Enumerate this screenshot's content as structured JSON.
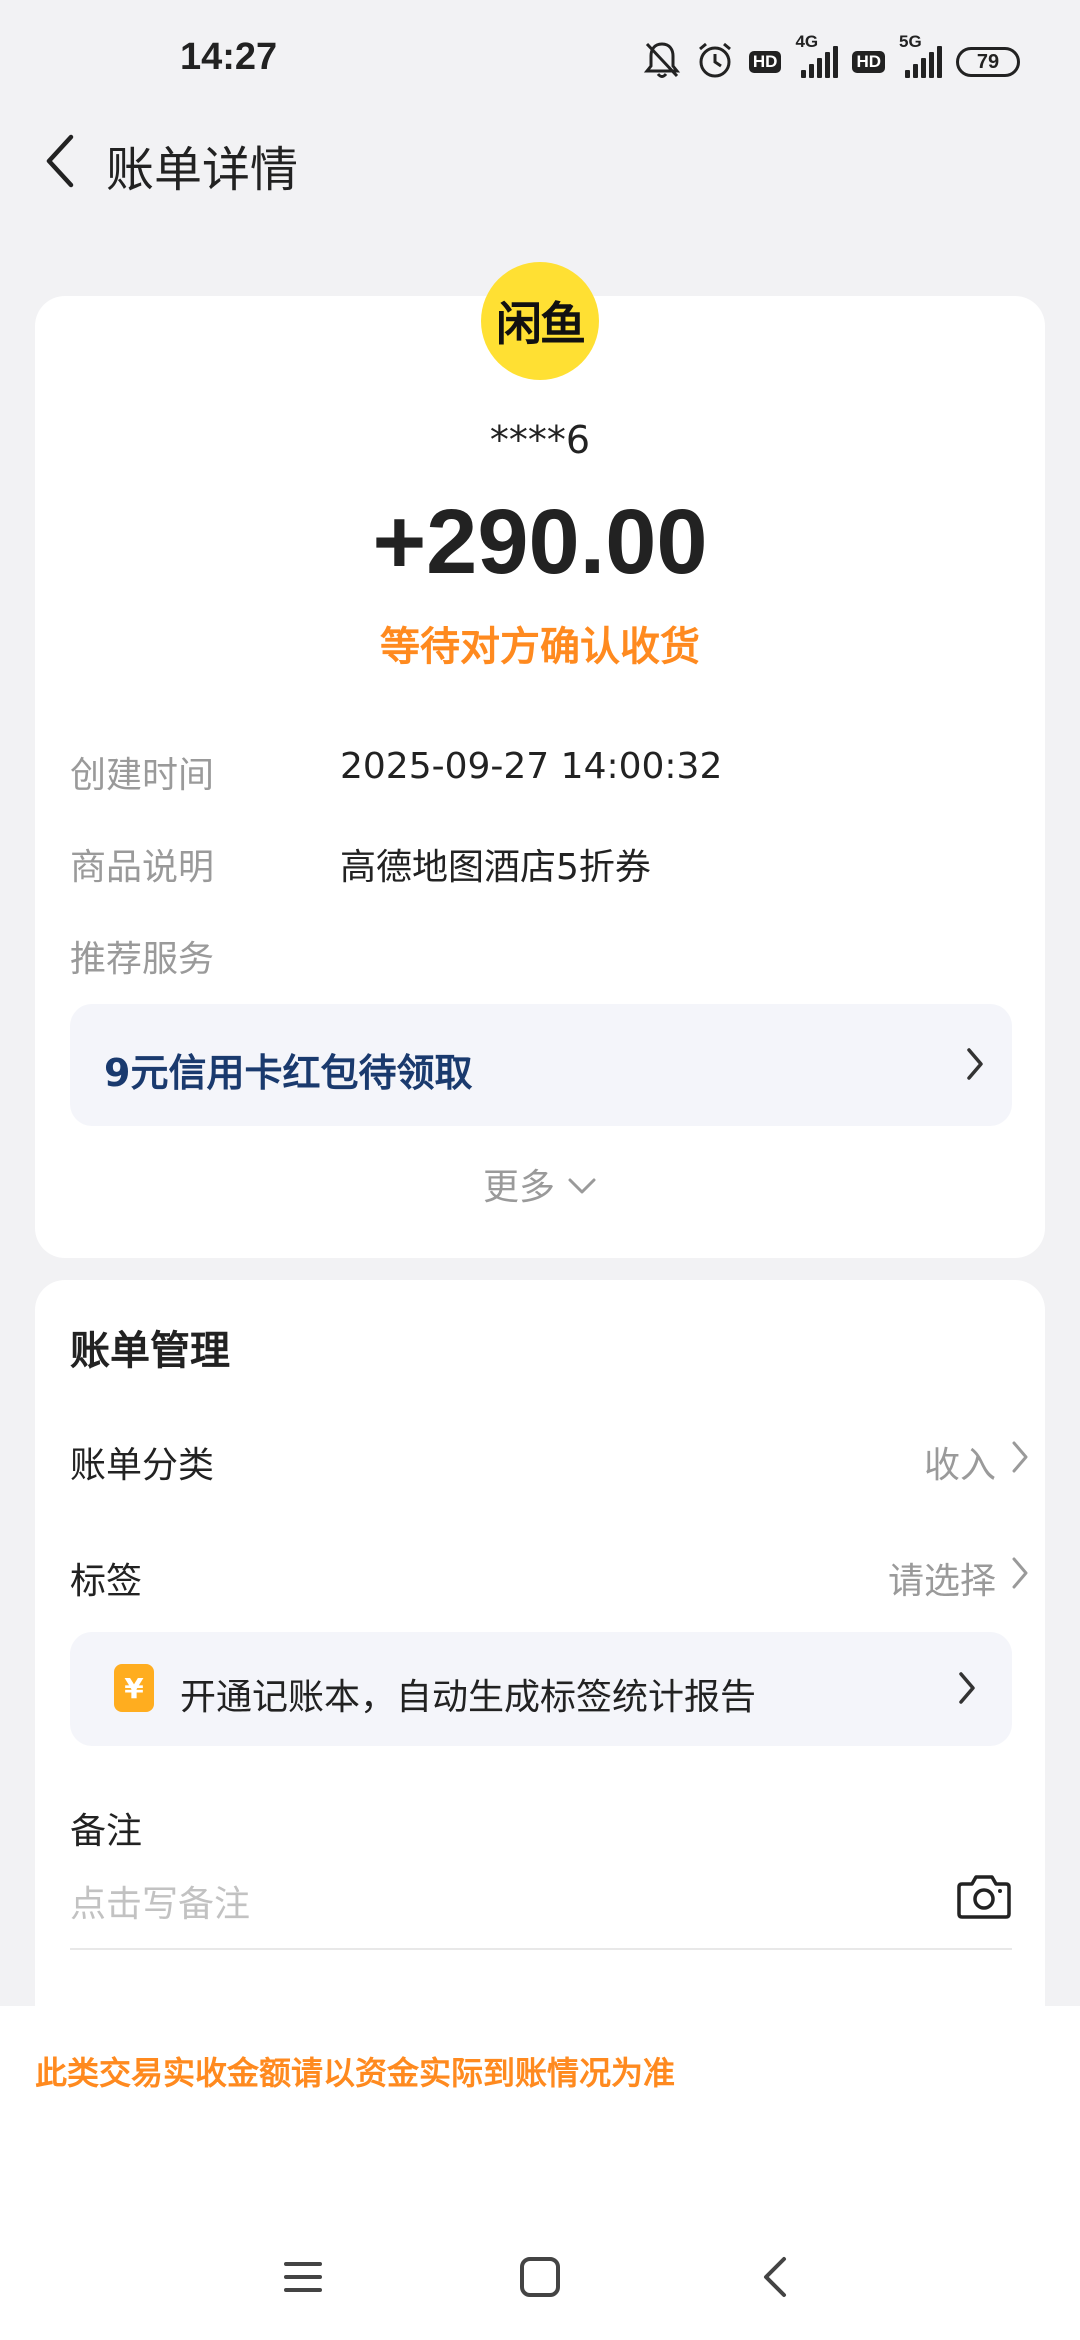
{
  "status_bar": {
    "time": "14:27",
    "hd1": "HD",
    "net1": "4G",
    "hd2": "HD",
    "net2": "5G",
    "battery": "79",
    "icons": [
      "bell-off-icon",
      "alarm-icon",
      "signal-icon",
      "battery-icon"
    ]
  },
  "header": {
    "title": "账单详情",
    "back_icon": "chevron-left-icon"
  },
  "transaction": {
    "logo_text": "闲鱼",
    "account": "****6",
    "amount": "+290.00",
    "status": "等待对方确认收货",
    "status_color": "#ff8a1f"
  },
  "details": {
    "created_label": "创建时间",
    "created_value": "2025-09-27 14:00:32",
    "product_label": "商品说明",
    "product_value": "高德地图酒店5折券",
    "service_label": "推荐服务"
  },
  "promo": {
    "text": "9元信用卡红包待领取",
    "color": "#1a3a6e"
  },
  "more": {
    "label": "更多"
  },
  "manage": {
    "title": "账单管理",
    "category_label": "账单分类",
    "category_value": "收入",
    "tag_label": "标签",
    "tag_value": "请选择",
    "notebook_icon": "¥",
    "notebook_text": "开通记账本，自动生成标签统计报告",
    "remark_label": "备注",
    "remark_placeholder": "点击写备注",
    "remark_value": ""
  },
  "footer": {
    "notice": "此类交易实收金额请以资金实际到账情况为准"
  },
  "nav": {
    "menu_icon": "menu-icon",
    "home_icon": "home-square-icon",
    "back_icon": "back-triangle-icon"
  }
}
